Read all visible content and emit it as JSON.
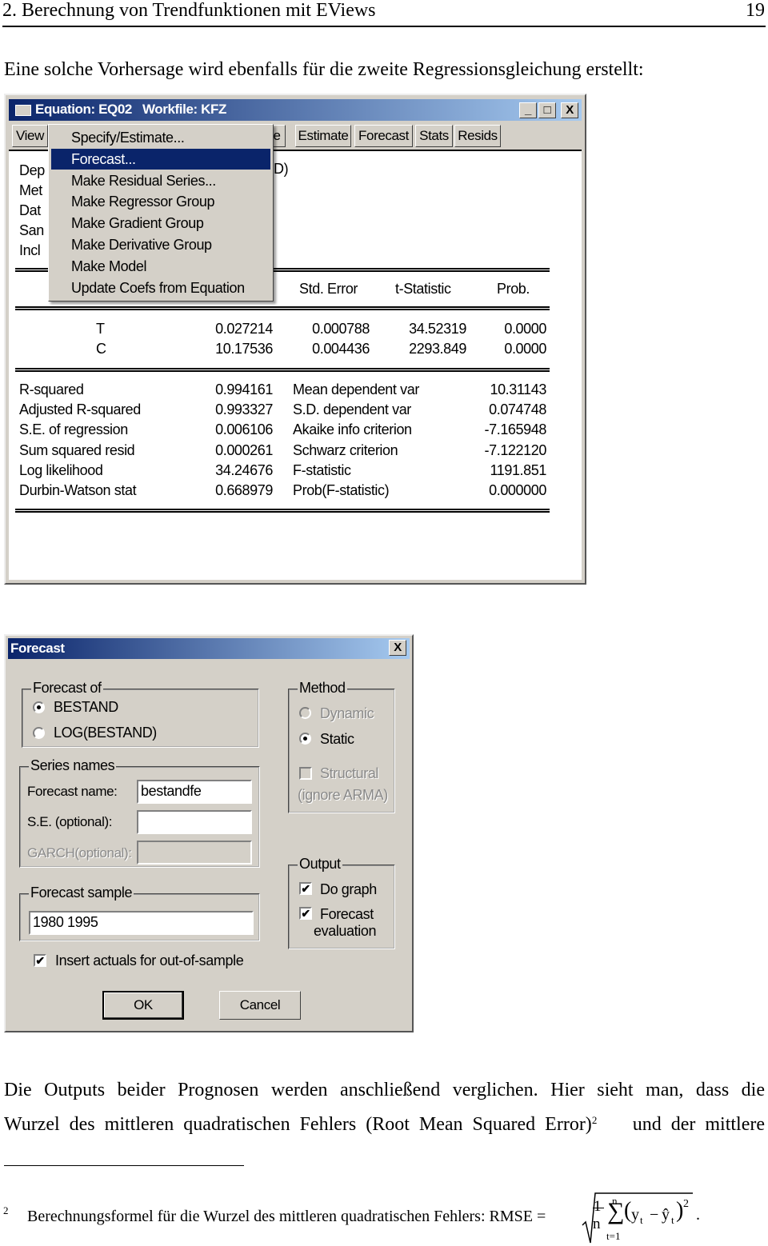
{
  "header": {
    "title": "2. Berechnung von Trendfunktionen mit EViews",
    "page": "19"
  },
  "intro": "Eine solche Vorhersage wird ebenfalls für die zweite Regressionsgleichung erstellt:",
  "equation_window": {
    "title": "Equation: EQ02   Workfile: KFZ",
    "buttons": {
      "minimize": "_",
      "maximize": "□",
      "close": "X"
    },
    "toolbar": [
      "View",
      "e",
      "Estimate",
      "Forecast",
      "Stats",
      "Resids"
    ],
    "menu": [
      "Specify/Estimate...",
      "Forecast...",
      "Make Residual Series...",
      "Make Regressor Group",
      "Make Gradient Group",
      "Make Derivative Group",
      "Make Model",
      "Update Coefs from Equation"
    ],
    "menu_selected": "Forecast...",
    "partial_labels": [
      "Dep",
      "Met",
      "Dat",
      "San",
      "Incl"
    ],
    "partial_right": "D)",
    "columns": [
      "Std. Error",
      "t-Statistic",
      "Prob."
    ],
    "coef_rows": [
      {
        "var": "T",
        "coef": "0.027214",
        "se": "0.000788",
        "t": "34.52319",
        "p": "0.0000"
      },
      {
        "var": "C",
        "coef": "10.17536",
        "se": "0.004436",
        "t": "2293.849",
        "p": "0.0000"
      }
    ],
    "stats": [
      {
        "l": "R-squared",
        "v": "0.994161",
        "l2": "Mean dependent var",
        "v2": "10.31143"
      },
      {
        "l": "Adjusted R-squared",
        "v": "0.993327",
        "l2": "S.D. dependent var",
        "v2": "0.074748"
      },
      {
        "l": "S.E. of regression",
        "v": "0.006106",
        "l2": "Akaike info criterion",
        "v2": "-7.165948"
      },
      {
        "l": "Sum squared resid",
        "v": "0.000261",
        "l2": "Schwarz criterion",
        "v2": "-7.122120"
      },
      {
        "l": "Log likelihood",
        "v": "34.24676",
        "l2": "F-statistic",
        "v2": "1191.851"
      },
      {
        "l": "Durbin-Watson stat",
        "v": "0.668979",
        "l2": "Prob(F-statistic)",
        "v2": "0.000000"
      }
    ]
  },
  "forecast_dialog": {
    "title": "Forecast",
    "close": "X",
    "forecast_of": {
      "label": "Forecast of",
      "options": [
        "BESTAND",
        "LOG(BESTAND)"
      ],
      "selected": "BESTAND"
    },
    "series_names": {
      "label": "Series names",
      "forecast_name_label": "Forecast name:",
      "forecast_name": "bestandfe",
      "se_label": "S.E. (optional):",
      "se_value": "",
      "garch_label": "GARCH(optional):"
    },
    "sample": {
      "label": "Forecast sample",
      "value": "1980 1995"
    },
    "method": {
      "label": "Method",
      "dynamic": "Dynamic",
      "static": "Static",
      "selected": "Static",
      "structural": "Structural",
      "ignore": "(ignore ARMA)"
    },
    "output": {
      "label": "Output",
      "do_graph": "Do graph",
      "eval1": "Forecast",
      "eval2": "evaluation",
      "do_graph_checked": true,
      "eval_checked": true
    },
    "insert_actuals": "Insert actuals for out-of-sample",
    "insert_checked": true,
    "ok": "OK",
    "cancel": "Cancel"
  },
  "body": {
    "line1": "Die Outputs beider Prognosen werden anschließend verglichen. Hier sieht man, dass die",
    "line2a": "Wurzel des mittleren quadratischen Fehlers (Root Mean Squared Error)",
    "line2sup": "2",
    "line2b": " und der mittlere"
  },
  "footnote": {
    "mark": "2",
    "text": "Berechnungsformel für die Wurzel des mittleren quadratischen Fehlers:  RMSE =",
    "formula": {
      "one": "1",
      "n": "n",
      "sum_top": "n",
      "sum_bottom": "t=1",
      "y": "y",
      "yhat": "ŷ",
      "sub": "t",
      "exp": "2",
      "end": "."
    }
  }
}
